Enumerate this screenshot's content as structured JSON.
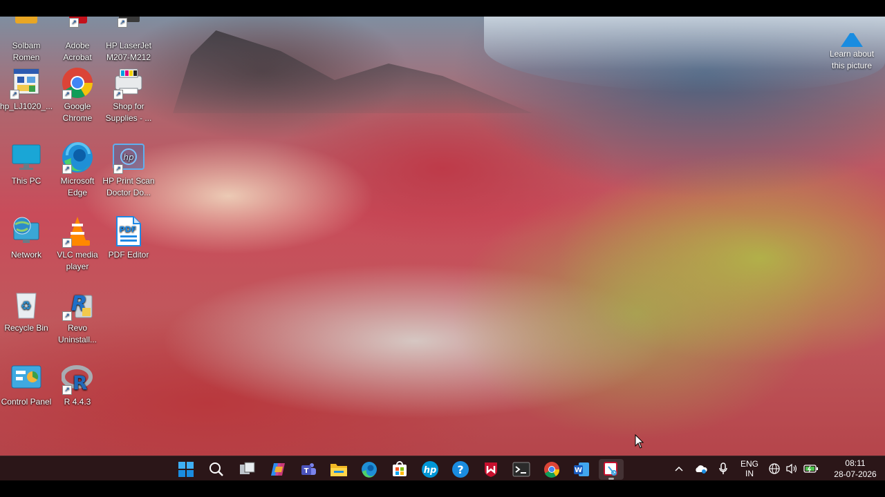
{
  "desktop": {
    "icons": [
      {
        "label": "Solbam\nRomen",
        "icon": "user-folder-icon"
      },
      {
        "label": "Adobe\nAcrobat",
        "icon": "adobe-acrobat-icon"
      },
      {
        "label": "HP LaserJet\nM207-M212",
        "icon": "printer-icon"
      },
      {
        "label": "hp_LJ1020_...",
        "icon": "hp-driver-icon"
      },
      {
        "label": "Google\nChrome",
        "icon": "chrome-icon"
      },
      {
        "label": "Shop for\nSupplies - ...",
        "icon": "shop-supplies-icon"
      },
      {
        "label": "This PC",
        "icon": "this-pc-icon"
      },
      {
        "label": "Microsoft\nEdge",
        "icon": "edge-icon"
      },
      {
        "label": "HP Print Scan\nDoctor Do...",
        "icon": "hp-print-scan-doctor-icon"
      },
      {
        "label": "Network",
        "icon": "network-icon"
      },
      {
        "label": "VLC media\nplayer",
        "icon": "vlc-icon"
      },
      {
        "label": "PDF Editor",
        "icon": "pdf-editor-icon"
      },
      {
        "label": "Recycle Bin",
        "icon": "recycle-bin-icon"
      },
      {
        "label": "Revo\nUninstall...",
        "icon": "revo-uninstaller-icon"
      },
      {
        "label": "Control Panel",
        "icon": "control-panel-icon"
      },
      {
        "label": "R 4.4.3",
        "icon": "r-language-icon"
      }
    ],
    "learn_about": {
      "label": "Learn about\nthis picture",
      "icon": "spotlight-icon"
    }
  },
  "taskbar": {
    "apps": [
      {
        "name": "Start",
        "icon": "windows-start-icon"
      },
      {
        "name": "Search",
        "icon": "search-icon"
      },
      {
        "name": "Task View",
        "icon": "task-view-icon"
      },
      {
        "name": "Copilot",
        "icon": "copilot-icon"
      },
      {
        "name": "Teams",
        "icon": "teams-icon"
      },
      {
        "name": "File Explorer",
        "icon": "file-explorer-icon"
      },
      {
        "name": "Microsoft Edge",
        "icon": "edge-icon"
      },
      {
        "name": "Microsoft Store",
        "icon": "store-icon"
      },
      {
        "name": "HP",
        "icon": "hp-icon"
      },
      {
        "name": "Get Help",
        "icon": "help-icon"
      },
      {
        "name": "McAfee",
        "icon": "mcafee-icon"
      },
      {
        "name": "Terminal",
        "icon": "terminal-icon"
      },
      {
        "name": "Google Chrome",
        "icon": "chrome-icon"
      },
      {
        "name": "Microsoft Word",
        "icon": "word-icon"
      },
      {
        "name": "Snipping Tool",
        "icon": "snipping-tool-icon"
      }
    ],
    "tray": {
      "lang_top": "ENG",
      "lang_bottom": "IN",
      "time": "08:11",
      "date": "28-07-2026"
    }
  },
  "colors": {
    "taskbar_bg": "#2b1618",
    "accent": "#0a84d6"
  }
}
